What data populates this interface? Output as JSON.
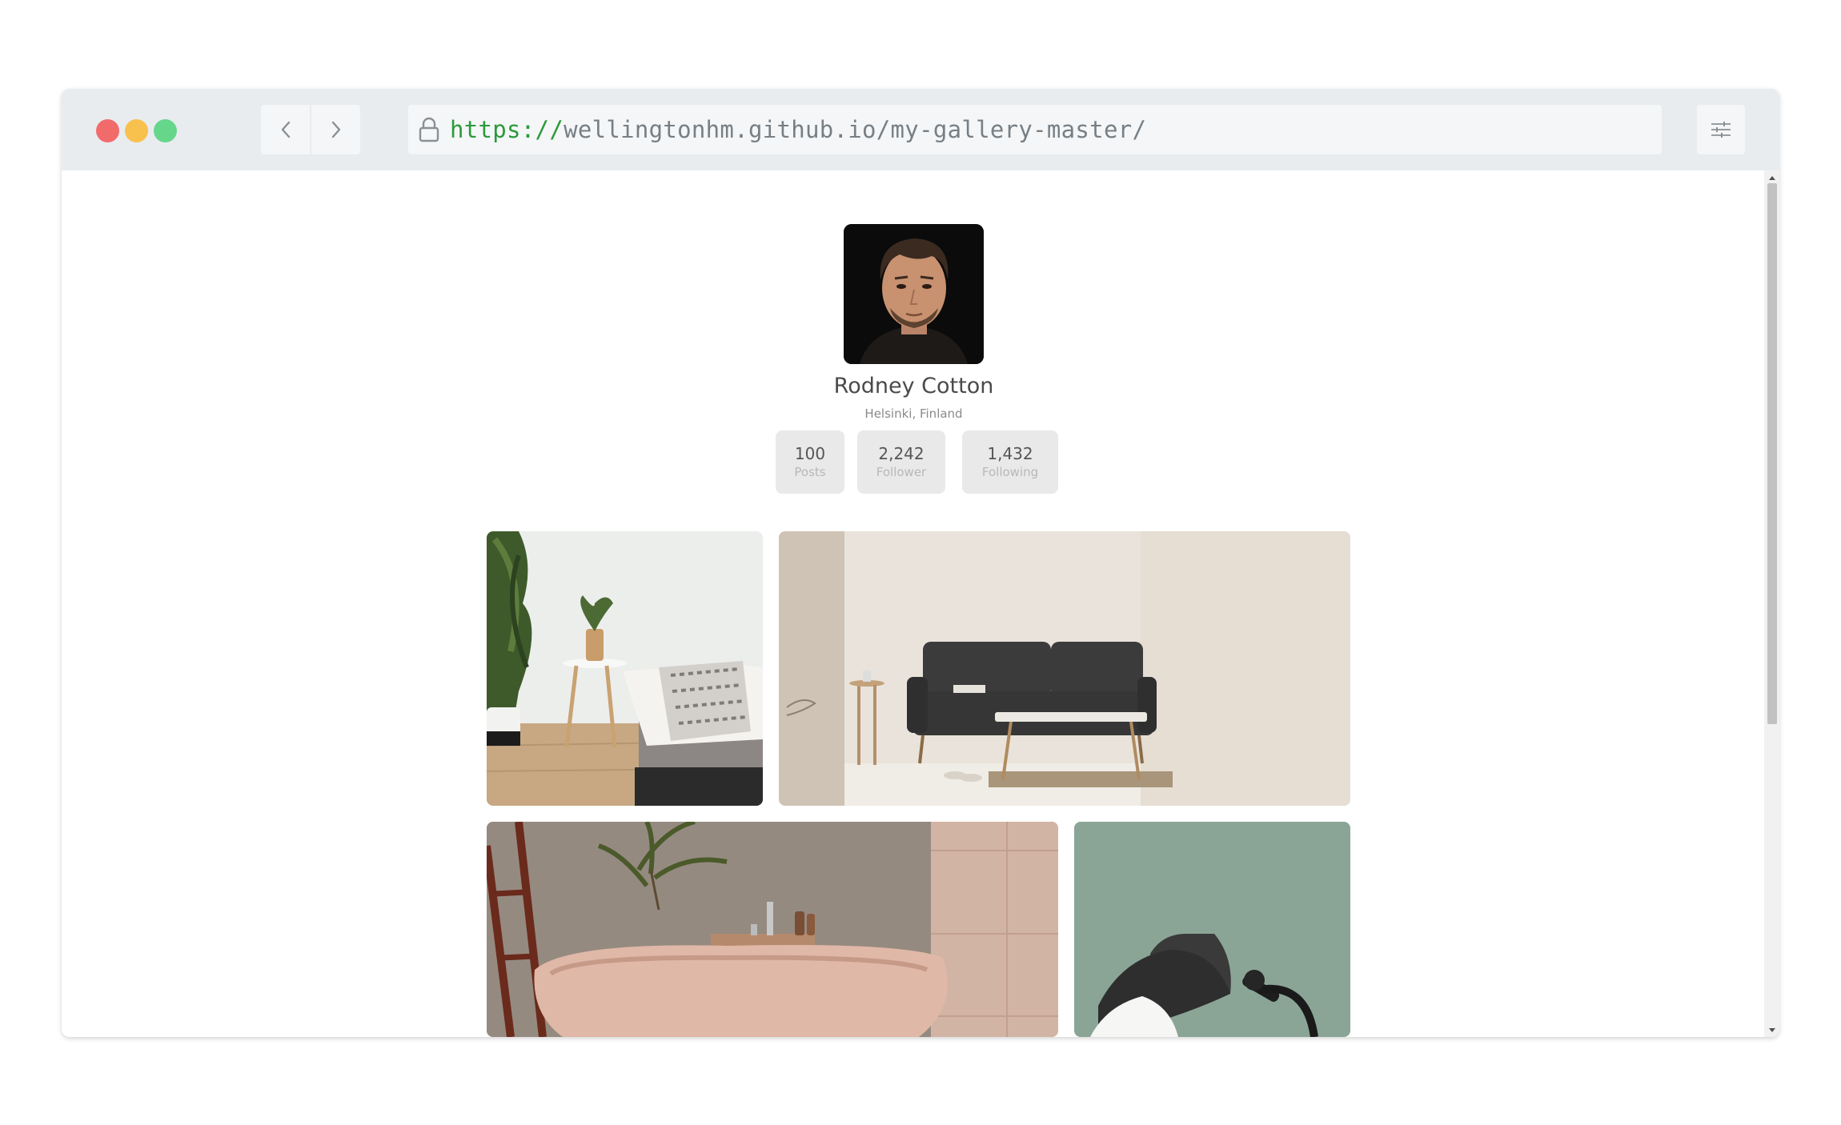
{
  "browser": {
    "url_protocol": "https://",
    "url_host": "wellingtonhm.github.io/my-gallery-master/",
    "traffic_lights": {
      "close": "#f26b6b",
      "minimize": "#f8c14e",
      "maximize": "#66d68a"
    }
  },
  "profile": {
    "name": "Rodney Cotton",
    "location": "Helsinki, Finland",
    "stats": [
      {
        "value": "100",
        "label": "Posts"
      },
      {
        "value": "2,242",
        "label": "Follower"
      },
      {
        "value": "1,432",
        "label": "Following"
      }
    ]
  },
  "gallery": {
    "photos": [
      {
        "subject": "bedroom with plants and white side table"
      },
      {
        "subject": "dark grey sofa in beige living room"
      },
      {
        "subject": "pink stone bathtub with palm plant"
      },
      {
        "subject": "black desk lamp on green wall"
      }
    ]
  },
  "icons": [
    "back-icon",
    "forward-icon",
    "lock-icon",
    "settings-sliders-icon",
    "scroll-up-icon",
    "scroll-down-icon"
  ]
}
